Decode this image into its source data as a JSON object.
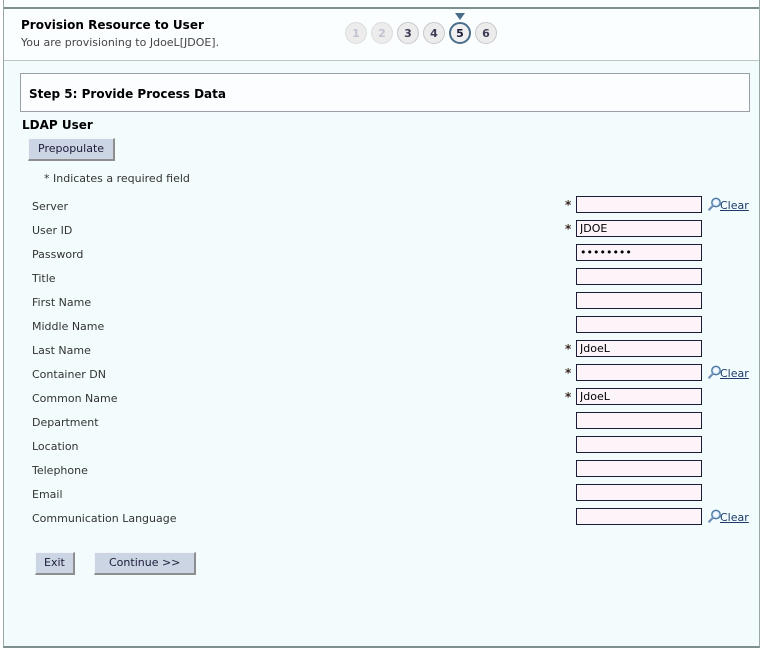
{
  "header": {
    "title": "Provision Resource to User",
    "subtitle": "You are provisioning to JdoeL[JDOE]."
  },
  "step_train": {
    "steps": [
      {
        "number": "1",
        "state": "done"
      },
      {
        "number": "2",
        "state": "done"
      },
      {
        "number": "3",
        "state": "visited"
      },
      {
        "number": "4",
        "state": "visited"
      },
      {
        "number": "5",
        "state": "current"
      },
      {
        "number": "6",
        "state": "visited"
      }
    ],
    "current_step": "5"
  },
  "step_header": {
    "text": "Step 5:  Provide Process Data"
  },
  "section": {
    "title": "LDAP User",
    "prepopulate_label": "Prepopulate",
    "required_note": "* Indicates a required field"
  },
  "fields": [
    {
      "label": "Server",
      "value": "",
      "required": true,
      "type": "text",
      "lookup": true,
      "clear_label": "Clear"
    },
    {
      "label": "User ID",
      "value": "JDOE",
      "required": true,
      "type": "text",
      "lookup": false,
      "clear_label": ""
    },
    {
      "label": "Password",
      "value": "password",
      "required": false,
      "type": "password",
      "lookup": false,
      "clear_label": ""
    },
    {
      "label": "Title",
      "value": "",
      "required": false,
      "type": "text",
      "lookup": false,
      "clear_label": ""
    },
    {
      "label": "First Name",
      "value": "",
      "required": false,
      "type": "text",
      "lookup": false,
      "clear_label": ""
    },
    {
      "label": "Middle Name",
      "value": "",
      "required": false,
      "type": "text",
      "lookup": false,
      "clear_label": ""
    },
    {
      "label": "Last Name",
      "value": "JdoeL",
      "required": true,
      "type": "text",
      "lookup": false,
      "clear_label": ""
    },
    {
      "label": "Container DN",
      "value": "",
      "required": true,
      "type": "text",
      "lookup": true,
      "clear_label": "Clear"
    },
    {
      "label": "Common Name",
      "value": "JdoeL",
      "required": true,
      "type": "text",
      "lookup": false,
      "clear_label": ""
    },
    {
      "label": "Department",
      "value": "",
      "required": false,
      "type": "text",
      "lookup": false,
      "clear_label": ""
    },
    {
      "label": "Location",
      "value": "",
      "required": false,
      "type": "text",
      "lookup": false,
      "clear_label": ""
    },
    {
      "label": "Telephone",
      "value": "",
      "required": false,
      "type": "text",
      "lookup": false,
      "clear_label": ""
    },
    {
      "label": "Email",
      "value": "",
      "required": false,
      "type": "text",
      "lookup": false,
      "clear_label": ""
    },
    {
      "label": "Communication Language",
      "value": "",
      "required": false,
      "type": "text",
      "lookup": true,
      "clear_label": "Clear"
    }
  ],
  "footer": {
    "exit_label": "Exit",
    "continue_label": "Continue >>"
  },
  "icons": {
    "lookup": "magnifier-icon"
  },
  "colors": {
    "page_background": "#f2fcfc",
    "input_background": "#fdf4fa",
    "input_border": "#1b1b3a",
    "button_face": "#ccd5e3",
    "link": "#1b3a6b",
    "current_step_ring": "#4a6d8c"
  }
}
